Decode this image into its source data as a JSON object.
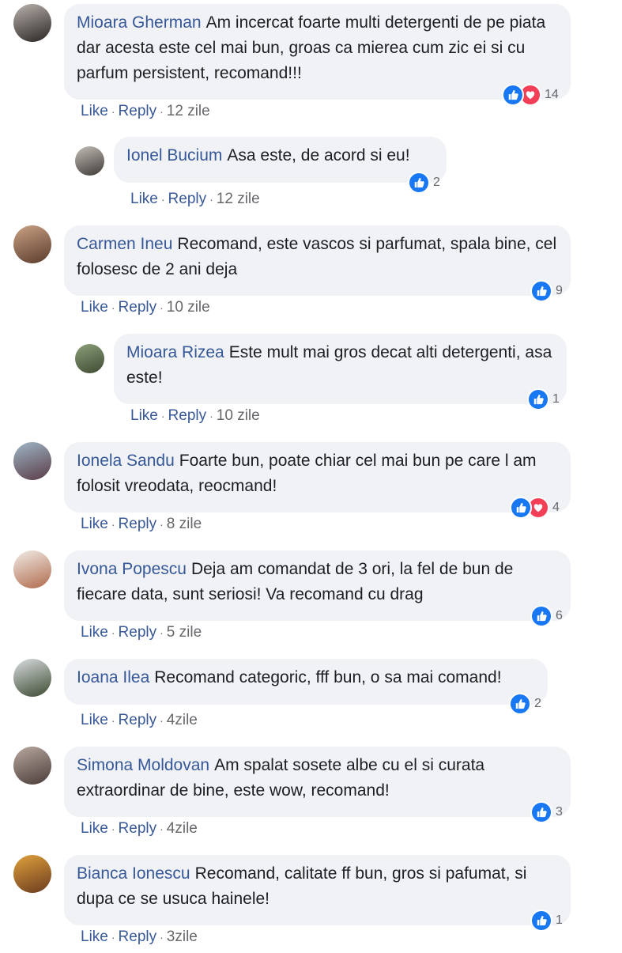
{
  "labels": {
    "like": "Like",
    "reply": "Reply",
    "separator": "·"
  },
  "colors": {
    "author": "#365899",
    "bubble": "#f0f2f5",
    "like_icon": "#1877f2",
    "love_icon": "#f33e58"
  },
  "comments": [
    {
      "author": "Mioara Gherman",
      "text": "Am incercat foarte multi detergenti de pe piata dar acesta este cel mai bun, groas ca mierea cum zic ei si cu parfum persistent, recomand!!!",
      "reactions": [
        "like-icon",
        "love-icon"
      ],
      "reaction_count": "14",
      "time": "12 zile",
      "reply": false
    },
    {
      "author": "Ionel Bucium",
      "text": "Asa este, de acord si eu!",
      "reactions": [
        "like-icon"
      ],
      "reaction_count": "2",
      "time": "12 zile",
      "reply": true
    },
    {
      "author": "Carmen Ineu",
      "text": "Recomand, este vascos si parfumat, spala bine, cel folosesc de 2 ani deja",
      "reactions": [
        "like-icon"
      ],
      "reaction_count": "9",
      "time": "10 zile",
      "reply": false
    },
    {
      "author": "Mioara Rizea",
      "text": "Este mult mai gros decat alti detergenti, asa este!",
      "reactions": [
        "like-icon"
      ],
      "reaction_count": "1",
      "time": "10 zile",
      "reply": true
    },
    {
      "author": "Ionela Sandu",
      "text": "Foarte bun, poate chiar cel mai bun pe care l am folosit vreodata, reocmand!",
      "reactions": [
        "like-icon",
        "love-icon"
      ],
      "reaction_count": "4",
      "time": "8 zile",
      "reply": false
    },
    {
      "author": "Ivona Popescu",
      "text": "Deja am comandat de 3 ori, la fel de bun de fiecare data, sunt seriosi! Va recomand cu drag",
      "reactions": [
        "like-icon"
      ],
      "reaction_count": "6",
      "time": "5 zile",
      "reply": false
    },
    {
      "author": "Ioana Ilea",
      "text": "Recomand categoric, fff bun, o sa mai comand!",
      "reactions": [
        "like-icon"
      ],
      "reaction_count": "2",
      "time": "4zile",
      "reply": false
    },
    {
      "author": "Simona Moldovan",
      "text": "Am spalat sosete albe cu el si curata extraordinar de bine, este wow, recomand!",
      "reactions": [
        "like-icon"
      ],
      "reaction_count": "3",
      "time": "4zile",
      "reply": false
    },
    {
      "author": "Bianca Ionescu",
      "text": "Recomand, calitate ff bun, gros si pafumat, si dupa ce se usuca hainele!",
      "reactions": [
        "like-icon"
      ],
      "reaction_count": "1",
      "time": "3zile",
      "reply": false
    }
  ]
}
